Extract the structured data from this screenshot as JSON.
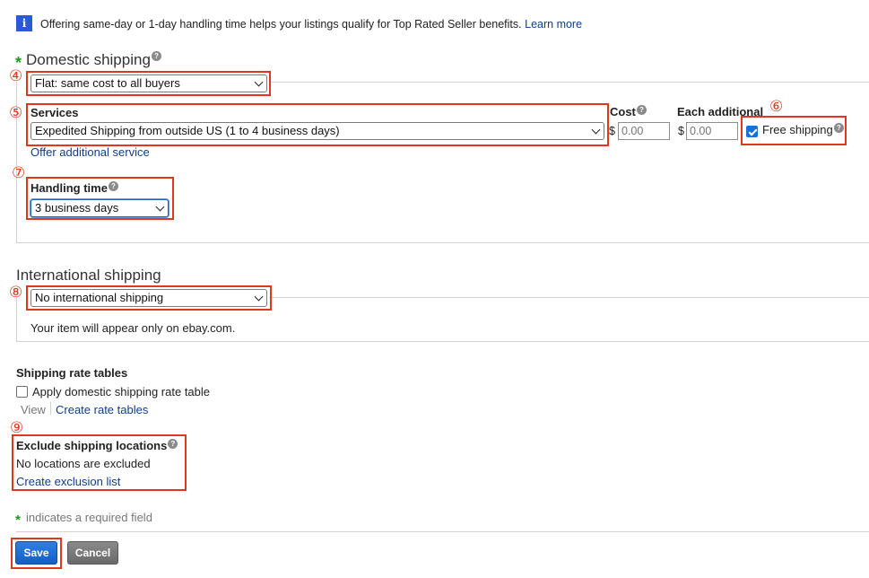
{
  "info_banner": {
    "text": "Offering same-day or 1-day handling time helps your listings qualify for Top Rated Seller benefits.",
    "link": "Learn more"
  },
  "domestic": {
    "title": "Domestic shipping",
    "type_select": "Flat: same cost to all buyers",
    "services_label": "Services",
    "service_select": "Expedited Shipping from outside US (1 to 4 business days)",
    "cost_label": "Cost",
    "each_additional_label": "Each additional",
    "currency": "$",
    "cost_placeholder": "0.00",
    "each_additional_placeholder": "0.00",
    "free_shipping_label": "Free shipping",
    "free_shipping_checked": true,
    "offer_additional_link": "Offer additional service",
    "handling_time_label": "Handling time",
    "handling_time_select": "3 business days"
  },
  "international": {
    "title": "International shipping",
    "select": "No international shipping",
    "note": "Your item will appear only on ebay.com."
  },
  "rate_tables": {
    "title": "Shipping rate tables",
    "checkbox_label": "Apply domestic shipping rate table",
    "view_label": "View",
    "create_link": "Create rate tables"
  },
  "exclude": {
    "title": "Exclude shipping locations",
    "status": "No locations are excluded",
    "create_link": "Create exclusion list"
  },
  "required_note": "indicates a required field",
  "required_star": "*",
  "help_glyph": "?",
  "info_glyph": "i",
  "buttons": {
    "save": "Save",
    "cancel": "Cancel"
  },
  "annotations": [
    "④",
    "⑤",
    "⑥",
    "⑦",
    "⑧",
    "⑨"
  ],
  "colors": {
    "annotation_red": "#e0371f",
    "link_blue": "#0e3e8a",
    "info_blue": "#2a5bd7",
    "required_green": "#1a9a1a",
    "save_blue": "#135fc4"
  }
}
